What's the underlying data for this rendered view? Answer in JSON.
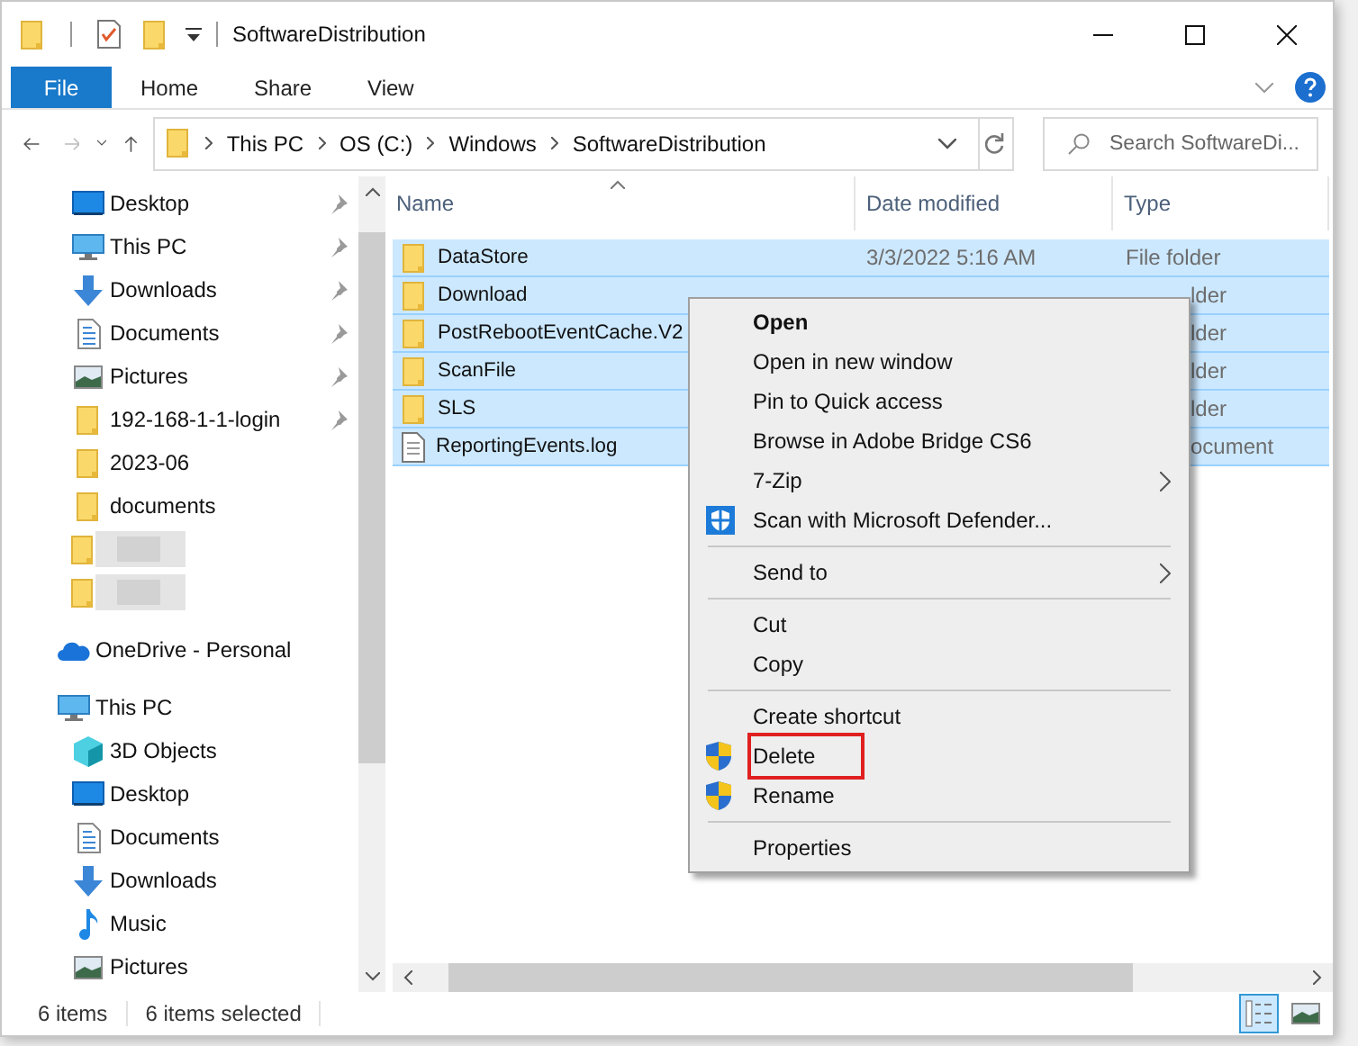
{
  "window": {
    "title": "SoftwareDistribution"
  },
  "ribbon": {
    "tabs": [
      {
        "label": "File",
        "selected": true
      },
      {
        "label": "Home",
        "selected": false
      },
      {
        "label": "Share",
        "selected": false
      },
      {
        "label": "View",
        "selected": false
      }
    ]
  },
  "address": {
    "path": [
      "This PC",
      "OS (C:)",
      "Windows",
      "SoftwareDistribution"
    ]
  },
  "search": {
    "placeholder": "Search SoftwareDi..."
  },
  "sidebar": {
    "items": [
      {
        "label": "Desktop",
        "kind": "desktop",
        "pinned": true
      },
      {
        "label": "This PC",
        "kind": "pc",
        "pinned": true
      },
      {
        "label": "Downloads",
        "kind": "downloads",
        "pinned": true
      },
      {
        "label": "Documents",
        "kind": "documents",
        "pinned": true
      },
      {
        "label": "Pictures",
        "kind": "pictures",
        "pinned": true
      },
      {
        "label": "192-168-1-1-login",
        "kind": "folder",
        "pinned": true
      },
      {
        "label": "2023-06",
        "kind": "folder",
        "pinned": false
      },
      {
        "label": "documents",
        "kind": "folder",
        "pinned": false
      },
      {
        "kind": "blurred"
      },
      {
        "kind": "blurred"
      },
      {
        "label": "OneDrive - Personal",
        "kind": "onedrive",
        "pinned": false
      },
      {
        "label": "This PC",
        "kind": "pc",
        "pinned": false,
        "children": [
          {
            "label": "3D Objects",
            "kind": "objects3d",
            "pinned": false
          },
          {
            "label": "Desktop",
            "kind": "desktop",
            "pinned": false
          },
          {
            "label": "Documents",
            "kind": "documents",
            "pinned": false
          },
          {
            "label": "Downloads",
            "kind": "downloads",
            "pinned": false
          },
          {
            "label": "Music",
            "kind": "music",
            "pinned": false
          },
          {
            "label": "Pictures",
            "kind": "pictures",
            "pinned": false
          }
        ]
      }
    ]
  },
  "table": {
    "columns": [
      "Name",
      "Date modified",
      "Type"
    ],
    "rows": [
      {
        "name": "DataStore",
        "kind": "folder",
        "date": "3/3/2022 5:16 AM",
        "type": "File folder",
        "selected": true
      },
      {
        "name": "Download",
        "kind": "folder",
        "type": "lder",
        "selected": true
      },
      {
        "name": "PostRebootEventCache.V2",
        "kind": "folder",
        "type": "lder",
        "selected": true
      },
      {
        "name": "ScanFile",
        "kind": "folder",
        "type": "lder",
        "selected": true
      },
      {
        "name": "SLS",
        "kind": "folder",
        "type": "lder",
        "selected": true
      },
      {
        "name": "ReportingEvents.log",
        "kind": "file",
        "type": "ocument",
        "selected": true
      }
    ]
  },
  "context_menu": {
    "items": [
      {
        "kind": "item",
        "label": "Open",
        "bold": true,
        "highlighted": false
      },
      {
        "kind": "item",
        "label": "Open in new window",
        "highlighted": false
      },
      {
        "kind": "item",
        "label": "Pin to Quick access",
        "highlighted": false
      },
      {
        "kind": "item",
        "label": "Browse in Adobe Bridge CS6",
        "highlighted": false
      },
      {
        "kind": "item",
        "label": "7-Zip",
        "submenu": true,
        "highlighted": false
      },
      {
        "kind": "defender_item",
        "label": "Scan with Microsoft Defender...",
        "highlighted": false
      },
      {
        "kind": "separator"
      },
      {
        "kind": "item",
        "label": "Send to",
        "submenu": true,
        "highlighted": false
      },
      {
        "kind": "separator"
      },
      {
        "kind": "item",
        "label": "Cut",
        "highlighted": false
      },
      {
        "kind": "item",
        "label": "Copy",
        "highlighted": false
      },
      {
        "kind": "separator"
      },
      {
        "kind": "item",
        "label": "Create shortcut",
        "highlighted": false
      },
      {
        "kind": "shield_item",
        "label": "Delete",
        "highlighted": true
      },
      {
        "kind": "shield_item",
        "label": "Rename",
        "highlighted": false
      },
      {
        "kind": "separator"
      },
      {
        "kind": "item",
        "label": "Properties",
        "highlighted": false
      }
    ]
  },
  "status_bar": {
    "count": "6 items",
    "selection": "6 items selected",
    "views": [
      {
        "kind": "details",
        "selected": true
      },
      {
        "kind": "thumbnails",
        "selected": false
      }
    ]
  }
}
